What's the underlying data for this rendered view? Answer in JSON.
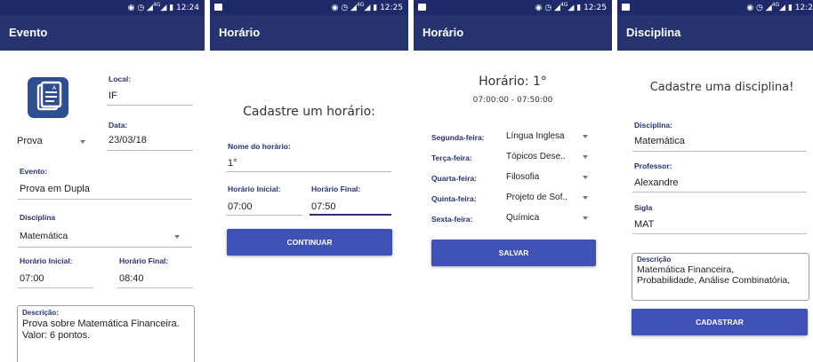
{
  "colors": {
    "status_bar": "#1f2a6b",
    "app_bar": "#27336f",
    "accent": "#3f51b5",
    "label": "#27336f"
  },
  "screens": [
    {
      "status_time": "12:24",
      "network": "4G",
      "app_title": "Evento",
      "icon": "document-icon",
      "local_label": "Local:",
      "local_value": "IF",
      "tipo_value": "Prova",
      "data_label": "Data:",
      "data_value": "23/03/18",
      "evento_label": "Evento:",
      "evento_value": "Prova em Dupla",
      "disciplina_label": "Disciplina",
      "disciplina_value": "Matemática",
      "inicio_label": "Horário Inicial:",
      "inicio_value": "07:00",
      "fim_label": "Horário Final:",
      "fim_value": "08:40",
      "descricao_label": "Descrição:",
      "descricao_line1": "Prova sobre Matemática Financeira.",
      "descricao_line2": "Valor: 6 pontos."
    },
    {
      "status_time": "12:25",
      "network": "4G",
      "app_title": "Horário",
      "heading": "Cadastre um horário:",
      "nome_label": "Nome do horário:",
      "nome_value": "1°",
      "inicio_label": "Horário Inicial:",
      "inicio_value": "07:00",
      "fim_label": "Horário Final:",
      "fim_value": "07:50",
      "button": "CONTINUAR"
    },
    {
      "status_time": "12:25",
      "network": "4G",
      "app_title": "Horário",
      "heading": "Horário: 1°",
      "time_range": "07:00:00 - 07:50:00",
      "days": [
        {
          "day": "Segunda-feira:",
          "subject": "Língua Inglesa"
        },
        {
          "day": "Terça-feira:",
          "subject": "Tópicos Dese.."
        },
        {
          "day": "Quarta-feira:",
          "subject": "Filosofia"
        },
        {
          "day": "Quinta-feira:",
          "subject": "Projeto de Sof.."
        },
        {
          "day": "Sexta-feira:",
          "subject": "Química"
        }
      ],
      "button": "SALVAR"
    },
    {
      "status_time": "12:2",
      "network": "4G",
      "app_title": "Disciplina",
      "heading": "Cadastre uma disciplina!",
      "disciplina_label": "Disciplina:",
      "disciplina_value": "Matemática",
      "professor_label": "Professor:",
      "professor_value": "Alexandre",
      "sigla_label": "Sigla",
      "sigla_value": "MAT",
      "descricao_label": "Descrição",
      "descricao_line1": "Matemática Financeira,",
      "descricao_line2": "Probabilidade, Análise Combinatória,",
      "button": "CADASTRAR"
    }
  ]
}
